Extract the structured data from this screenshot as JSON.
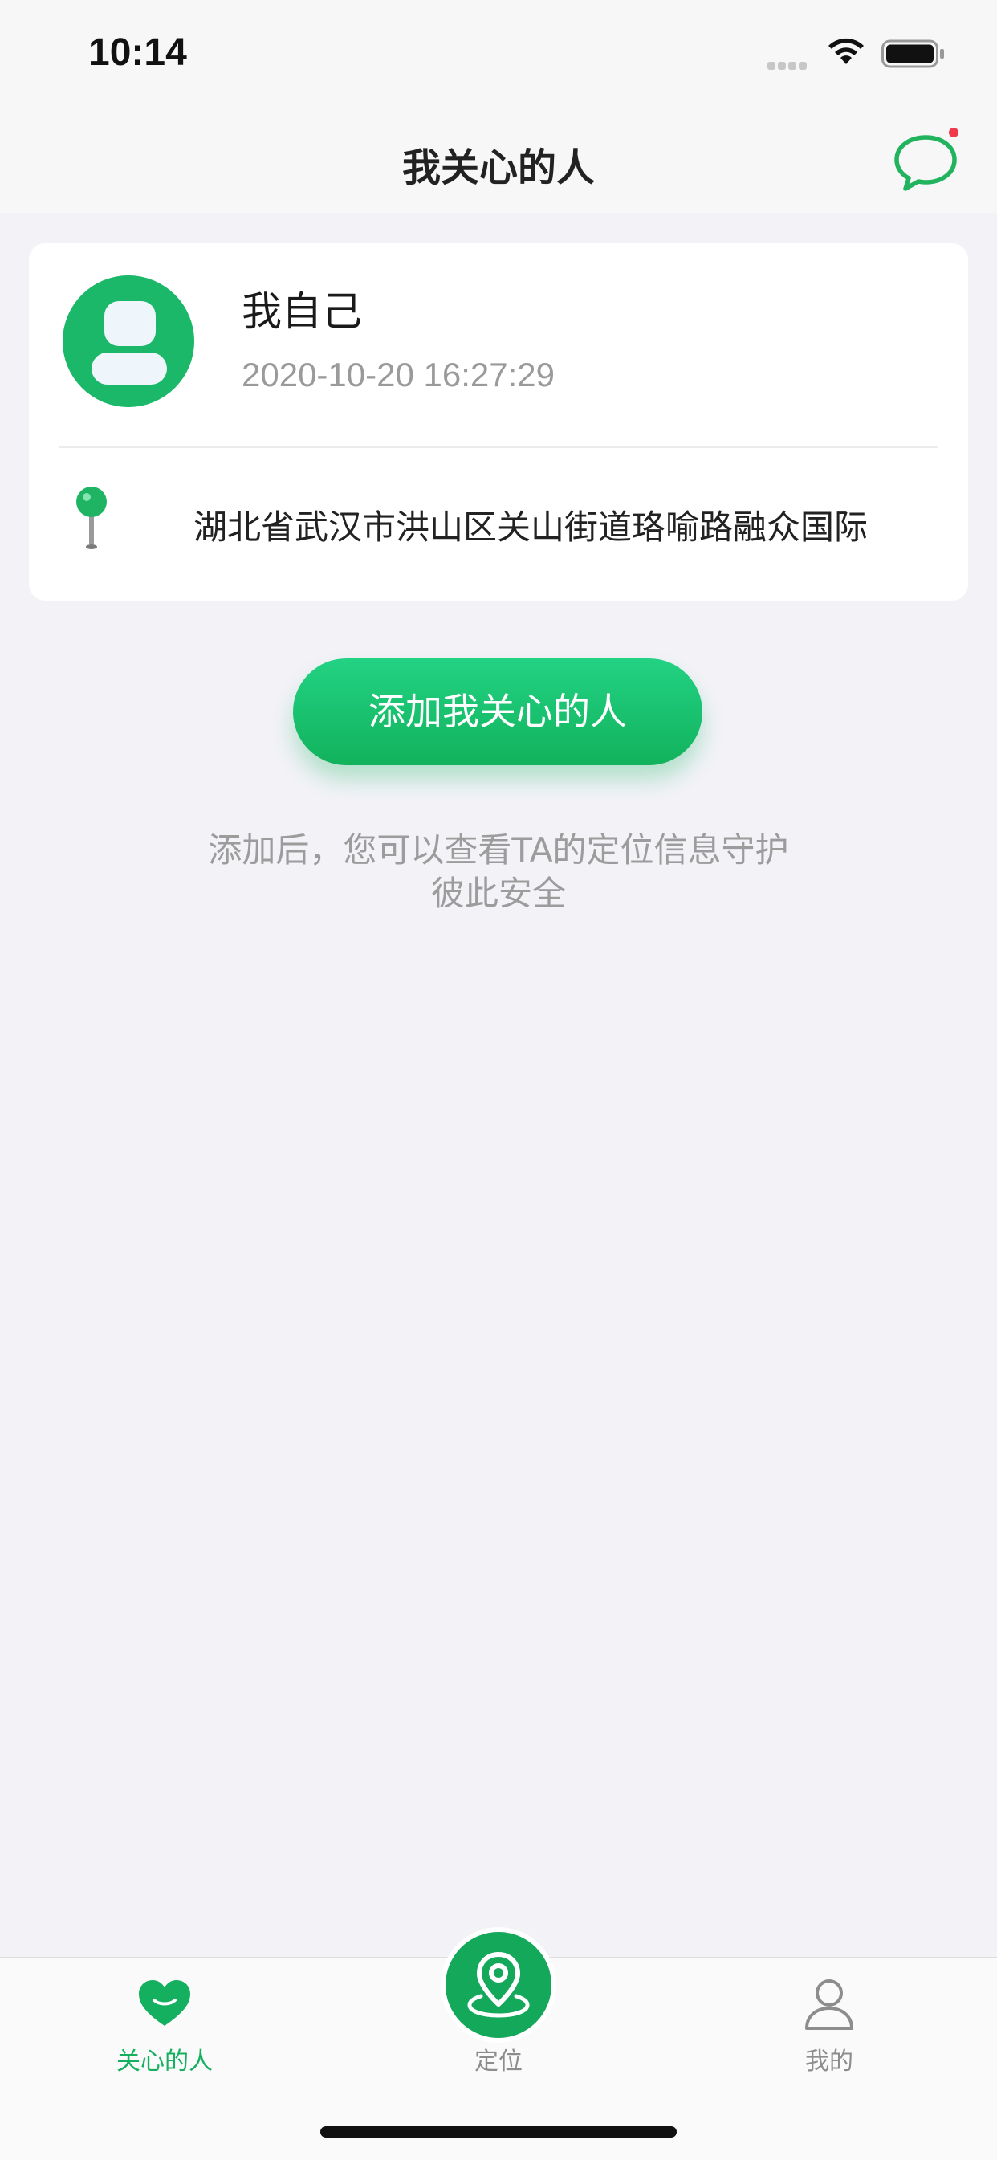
{
  "status_bar": {
    "time": "10:14"
  },
  "nav": {
    "title": "我关心的人",
    "message_icon": "chat-bubble-icon",
    "has_unread": true
  },
  "self_card": {
    "name": "我自己",
    "timestamp": "2020-10-20 16:27:29",
    "address": "湖北省武汉市洪山区关山街道珞喻路融众国际",
    "location_icon": "map-pin-icon"
  },
  "add_button": {
    "label": "添加我关心的人"
  },
  "hint": {
    "line1": "添加后，您可以查看TA的定位信息守护",
    "line2": "彼此安全"
  },
  "tabs": [
    {
      "label": "关心的人",
      "icon": "heart-icon",
      "active": true
    },
    {
      "label": "定位",
      "icon": "location-pin-icon",
      "active": false
    },
    {
      "label": "我的",
      "icon": "person-icon",
      "active": false
    }
  ],
  "colors": {
    "accent": "#14b060",
    "background": "#f2f2f7",
    "badge": "#f0394a"
  }
}
